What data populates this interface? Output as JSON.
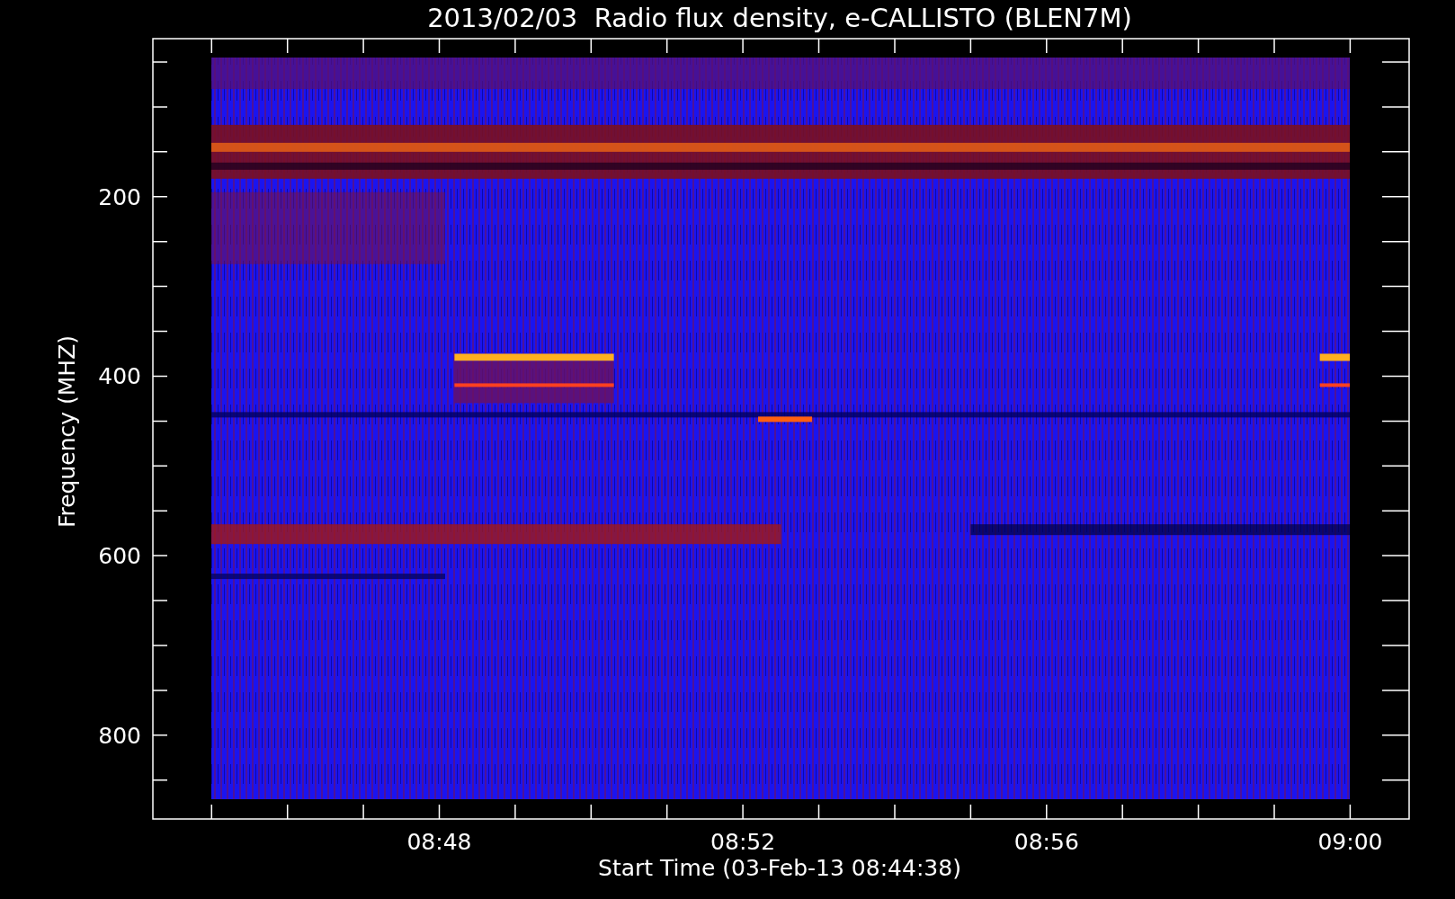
{
  "title": "2013/02/03  Radio flux density, e-CALLISTO (BLEN7M)",
  "y_axis": {
    "label": "Frequency (MHZ)",
    "ticks": [
      "200",
      "400",
      "600",
      "800"
    ]
  },
  "x_axis": {
    "label": "Start Time (03-Feb-13 08:44:38)",
    "ticks": [
      "08:48",
      "08:52",
      "08:56",
      "09:00"
    ]
  }
}
